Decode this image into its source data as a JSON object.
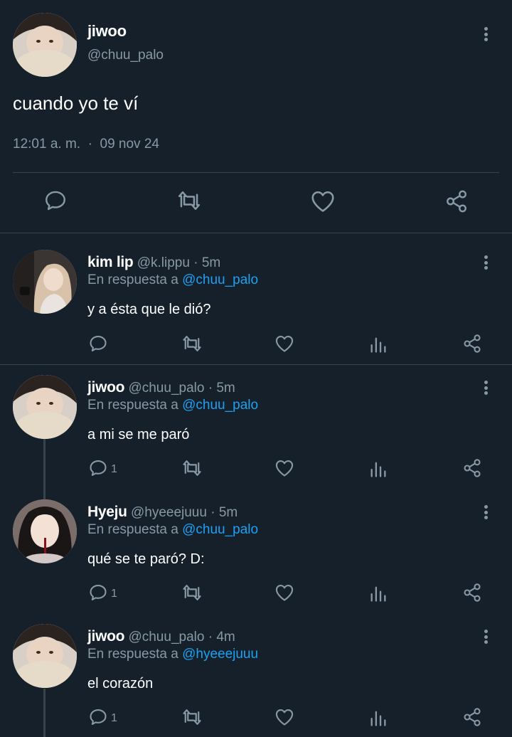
{
  "main_tweet": {
    "name": "jiwoo",
    "handle": "@chuu_palo",
    "text": "cuando yo te ví",
    "time": "12:01 a. m.",
    "separator": "·",
    "date": "09 nov 24",
    "actions": [
      "reply-icon",
      "retweet-icon",
      "like-icon",
      "share-icon"
    ]
  },
  "replies": [
    {
      "name": "kim lip",
      "handle": "@k.lippu",
      "dot": "·",
      "time": "5m",
      "in_reply_prefix": "En respuesta a",
      "in_reply_to": "@chuu_palo",
      "text": "y a ésta que le dió?",
      "reply_count": ""
    },
    {
      "name": "jiwoo",
      "handle": "@chuu_palo",
      "dot": "·",
      "time": "5m",
      "in_reply_prefix": "En respuesta a",
      "in_reply_to": "@chuu_palo",
      "text": "a mi se me paró",
      "reply_count": "1"
    },
    {
      "name": "Hyeju",
      "handle": "@hyeeejuuu",
      "dot": "·",
      "time": "5m",
      "in_reply_prefix": "En respuesta a",
      "in_reply_to": "@chuu_palo",
      "text": "qué se te paró? D:",
      "reply_count": "1"
    },
    {
      "name": "jiwoo",
      "handle": "@chuu_palo",
      "dot": "·",
      "time": "4m",
      "in_reply_prefix": "En respuesta a",
      "in_reply_to": "@hyeeejuuu",
      "text": "el corazón",
      "reply_count": "1"
    }
  ],
  "colors": {
    "background": "#15202b",
    "secondary_text": "#8899a6",
    "mention": "#1da1f2",
    "divider": "#38444d"
  }
}
